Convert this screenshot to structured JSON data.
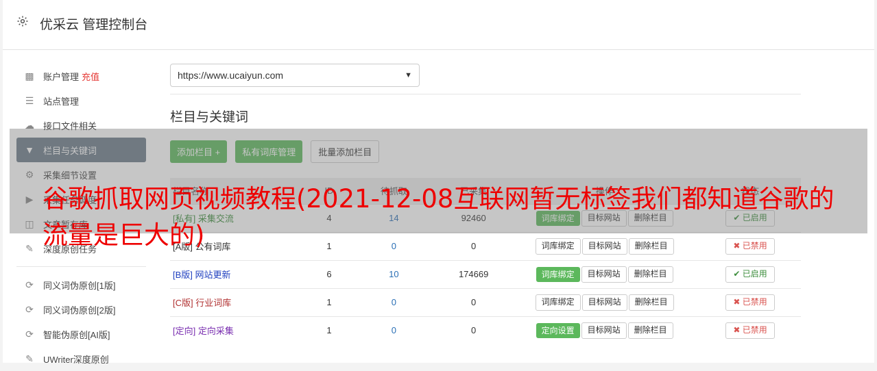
{
  "header": {
    "title": "优采云 管理控制台"
  },
  "sidebar": {
    "items": [
      {
        "icon": "bar-chart-icon",
        "label": "账户管理",
        "badge": "充值"
      },
      {
        "icon": "server-icon",
        "label": "站点管理"
      },
      {
        "icon": "cloud-upload-icon",
        "label": "接口文件相关"
      },
      {
        "icon": "filter-icon",
        "label": "栏目与关键词",
        "active": true
      },
      {
        "icon": "cogs-icon",
        "label": "采集细节设置"
      },
      {
        "icon": "play-circle-icon",
        "label": "采集任务调度"
      },
      {
        "icon": "database-icon",
        "label": "文章暂存库"
      },
      {
        "icon": "edit-icon",
        "label": "深度原创任务"
      }
    ],
    "tools": [
      {
        "icon": "refresh-icon",
        "label": "同义词伪原创[1版]"
      },
      {
        "icon": "refresh-icon",
        "label": "同义词伪原创[2版]"
      },
      {
        "icon": "refresh-icon",
        "label": "智能伪原创[AI版]"
      },
      {
        "icon": "edit-icon",
        "label": "UWriter深度原创"
      }
    ]
  },
  "main": {
    "site_select": "https://www.ucaiyun.com",
    "section_title": "栏目与关键词",
    "buttons": {
      "add": "添加栏目 +",
      "private": "私有词库管理",
      "batch": "批量添加栏目"
    },
    "table": {
      "headers": [
        "栏目名称",
        "ID",
        "待抓取",
        "已采集",
        "操作",
        "状态"
      ],
      "rows": [
        {
          "tag": "[私有]",
          "name": "采集交流",
          "color": "#3c8d3c",
          "id": "4",
          "pending": "14",
          "collected": "92460",
          "op1": "词库绑定",
          "op1_green": true,
          "status": "已启用",
          "enabled": true
        },
        {
          "tag": "[A版]",
          "name": "公有词库",
          "color": "#333333",
          "id": "1",
          "pending": "0",
          "collected": "0",
          "op1": "词库绑定",
          "op1_green": false,
          "status": "已禁用",
          "enabled": false
        },
        {
          "tag": "[B版]",
          "name": "网站更新",
          "color": "#1f3fbf",
          "id": "6",
          "pending": "10",
          "collected": "174669",
          "op1": "词库绑定",
          "op1_green": true,
          "status": "已启用",
          "enabled": true
        },
        {
          "tag": "[C版]",
          "name": "行业词库",
          "color": "#b03030",
          "id": "1",
          "pending": "0",
          "collected": "0",
          "op1": "词库绑定",
          "op1_green": false,
          "status": "已禁用",
          "enabled": false
        },
        {
          "tag": "[定向]",
          "name": "定向采集",
          "color": "#7a2fb0",
          "id": "1",
          "pending": "0",
          "collected": "0",
          "op1": "定向设置",
          "op1_green": true,
          "status": "已禁用",
          "enabled": false
        }
      ],
      "op2": "目标网站",
      "op3": "删除栏目"
    }
  },
  "overlay": {
    "text": "谷歌抓取网页视频教程(2021-12-08互联网暂无标签我们都知道谷歌的流量是巨大的)"
  }
}
